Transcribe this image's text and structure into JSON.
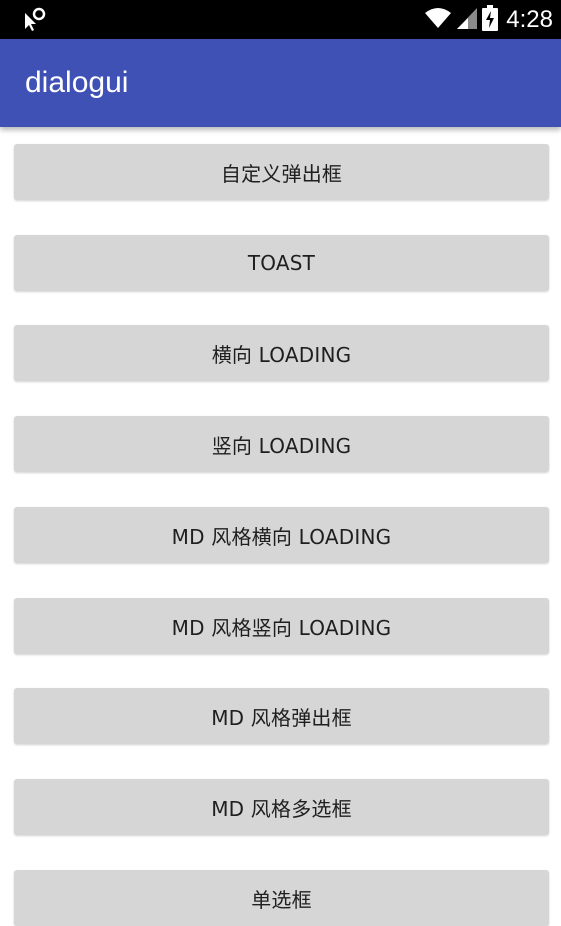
{
  "status_bar": {
    "time": "4:28",
    "left_icon": "cursor-icon",
    "icons": [
      "wifi-icon",
      "signal-icon",
      "battery-charging-icon"
    ]
  },
  "app_bar": {
    "title": "dialogui",
    "color": "#3f51b5"
  },
  "buttons": [
    {
      "label": "自定义弹出框"
    },
    {
      "label": "TOAST"
    },
    {
      "label": "横向 LOADING"
    },
    {
      "label": "竖向 LOADING"
    },
    {
      "label": "MD 风格横向 LOADING"
    },
    {
      "label": "MD 风格竖向 LOADING"
    },
    {
      "label": "MD 风格弹出框"
    },
    {
      "label": "MD 风格多选框"
    },
    {
      "label": "单选框"
    }
  ]
}
